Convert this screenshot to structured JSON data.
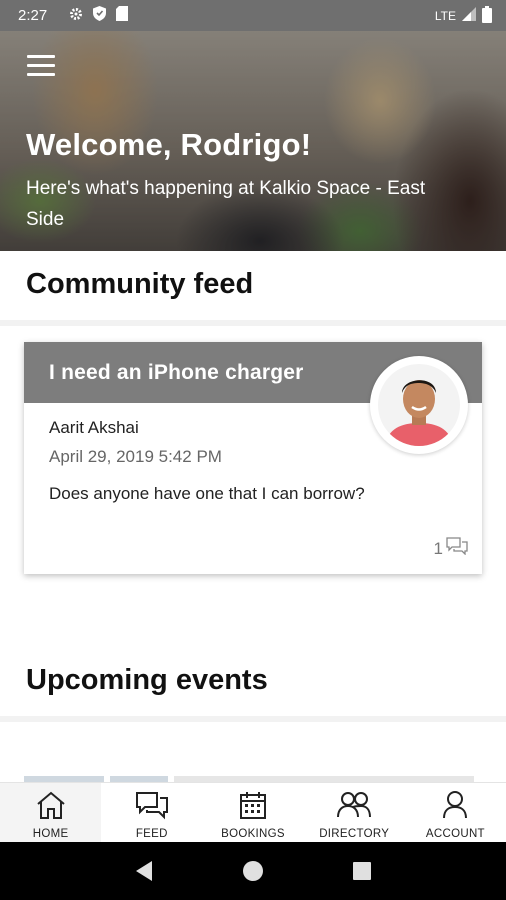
{
  "status_bar": {
    "time": "2:27",
    "network": "LTE"
  },
  "hero": {
    "title": "Welcome, Rodrigo!",
    "subtitle": "Here's what's happening at Kalkio Space - East Side"
  },
  "feed": {
    "section_title": "Community feed",
    "posts": [
      {
        "title": "I need an iPhone charger",
        "author": "Aarit Akshai",
        "date": "April 29, 2019 5:42 PM",
        "body": "Does anyone have one that I can borrow?",
        "comment_count": "1"
      }
    ]
  },
  "events": {
    "section_title": "Upcoming events"
  },
  "tabs": [
    {
      "label": "HOME",
      "icon": "home-icon"
    },
    {
      "label": "FEED",
      "icon": "chat-icon"
    },
    {
      "label": "BOOKINGS",
      "icon": "calendar-icon"
    },
    {
      "label": "DIRECTORY",
      "icon": "people-icon"
    },
    {
      "label": "ACCOUNT",
      "icon": "person-icon"
    }
  ],
  "colors": {
    "card_header": "#7d7d7d",
    "status_bar": "#6f6f6f",
    "nav_bar": "#000000"
  }
}
